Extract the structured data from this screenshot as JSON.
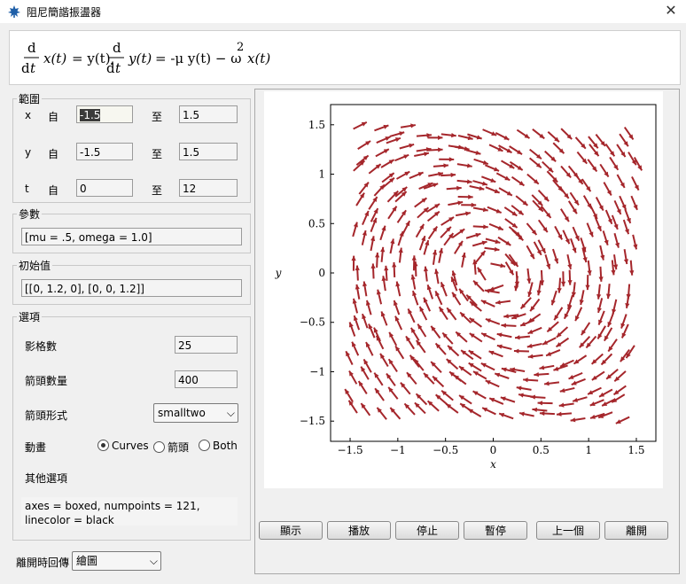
{
  "window": {
    "title": "阻尼簡諧振盪器",
    "close_glyph": "✕"
  },
  "equation": {
    "d": "d",
    "dt_d": "d",
    "dt_t": "t",
    "x_of_t": "x(t)",
    "eq1": "= y(t),",
    "y_of_t": "y(t)",
    "eq2": "= -μ y(t) − ω",
    "exp": "2",
    "tail": "x(t)"
  },
  "range": {
    "legend": "範圍",
    "from_label": "自",
    "to_label": "至",
    "rows": [
      {
        "var": "x",
        "from": "-1.5",
        "to": "1.5"
      },
      {
        "var": "y",
        "from": "-1.5",
        "to": "1.5"
      },
      {
        "var": "t",
        "from": "0",
        "to": "12"
      }
    ]
  },
  "params": {
    "legend": "參數",
    "value": "[mu = .5, omega = 1.0]"
  },
  "init": {
    "legend": "初始值",
    "value": "[[0, 1.2, 0], [0, 0, 1.2]]"
  },
  "options": {
    "legend": "選項",
    "frames_label": "影格數",
    "frames_value": "25",
    "arrows_label": "箭頭數量",
    "arrows_value": "400",
    "arrowtype_label": "箭頭形式",
    "arrowtype_value": "smalltwo",
    "animate_label": "動畫",
    "radio_curves": "Curves",
    "radio_arrows": "箭頭",
    "radio_both": "Both",
    "selected": "Curves",
    "other_label": "其他選項",
    "other_value": "axes = boxed, numpoints = 121, linecolor = black"
  },
  "exit": {
    "label": "離開時回傳",
    "value": "繪圖"
  },
  "buttons": {
    "show": "顯示",
    "play": "播放",
    "stop": "停止",
    "pause": "暫停",
    "prev": "上一個",
    "quit": "離開"
  },
  "chart_data": {
    "type": "vector_field",
    "xlabel": "x",
    "ylabel": "y",
    "xlim": [
      -1.5,
      1.5
    ],
    "ylim": [
      -1.5,
      1.5
    ],
    "xticks": [
      "−1.5",
      "−1",
      "−0.5",
      "0",
      "0.5",
      "1",
      "1.5"
    ],
    "yticks": [
      "1.5",
      "1",
      "0.5",
      "0",
      "−0.5",
      "−1",
      "−1.5"
    ],
    "field": {
      "dx": "y",
      "dy": "-0.5*y - 1.0*x"
    },
    "arrow_color": "#a5262b",
    "grid_n": 20
  }
}
